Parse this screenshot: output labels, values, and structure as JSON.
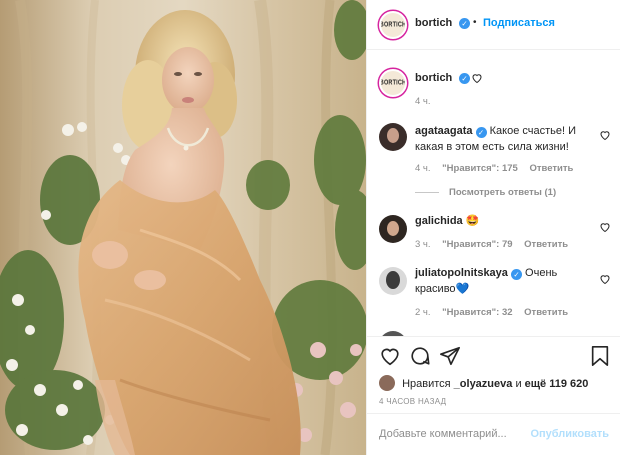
{
  "post": {
    "author": "bortich",
    "author_avatar_text": "BORTICH",
    "follow_label": "Подписаться",
    "separator": "•",
    "caption_time": "4 ч.",
    "view_replies": "Посмотреть ответы (1)",
    "comments": [
      {
        "user": "agataagata",
        "verified": true,
        "text": "Какое счастье! И какая в этом есть сила жизни!",
        "time": "4 ч.",
        "likes": "\"Нравится\": 175",
        "reply": "Ответить"
      },
      {
        "user": "galichida",
        "verified": false,
        "text": "🤩",
        "time": "3 ч.",
        "likes": "\"Нравится\": 79",
        "reply": "Ответить"
      },
      {
        "user": "juliatopolnitskaya",
        "verified": true,
        "text": "Очень красиво💙",
        "time": "2 ч.",
        "likes": "\"Нравится\": 32",
        "reply": "Ответить"
      }
    ],
    "liked_by": {
      "prefix": "Нравится",
      "user": "_olyazueva",
      "middle": "и",
      "count": "ещё 119 620"
    },
    "posted_ago": "4 ЧАСОВ НАЗАД",
    "add_comment_placeholder": "Добавьте комментарий...",
    "publish_label": "Опубликовать"
  },
  "icons": {
    "verified": "✓",
    "like": "heart-icon",
    "comment": "comment-icon",
    "share": "paper-plane-icon",
    "save": "bookmark-icon"
  },
  "colors": {
    "accent": "#0095f6",
    "verified": "#3897f0",
    "muted": "#8e8e8e",
    "publish_disabled": "#b2dffc"
  }
}
